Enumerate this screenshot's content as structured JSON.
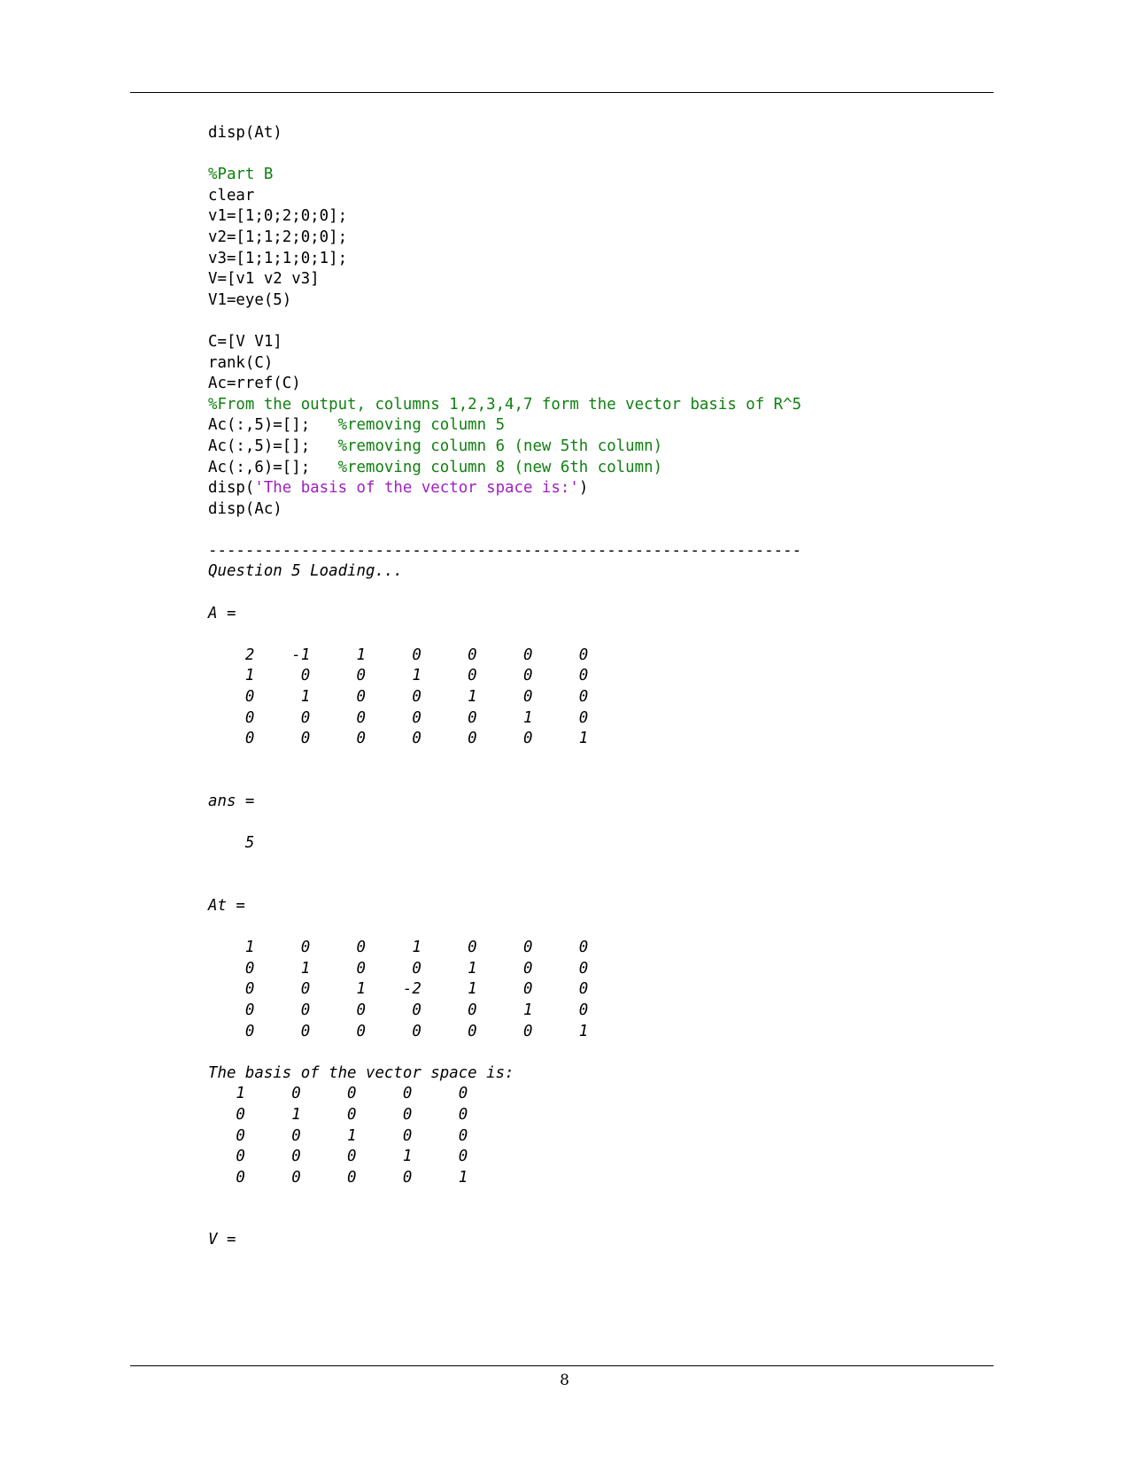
{
  "document": {
    "page_number": "8",
    "has_header_rule": true,
    "has_footer_rule": true,
    "colors": {
      "text": "#000000",
      "comment_green": "#108010",
      "string_purple": "#a020c0"
    }
  },
  "code": {
    "l01": "disp(At)",
    "l02": "",
    "l03_comment": "%Part B",
    "l04": "clear",
    "l05": "v1=[1;0;2;0;0];",
    "l06": "v2=[1;1;2;0;0];",
    "l07": "v3=[1;1;1;0;1];",
    "l08": "V=[v1 v2 v3]",
    "l09": "V1=eye(5)",
    "l10": "",
    "l11": "C=[V V1]",
    "l12": "rank(C)",
    "l13": "Ac=rref(C)",
    "l14_comment": "%From the output, columns 1,2,3,4,7 form the vector basis of R^5",
    "l15_code": "Ac(:,5)=[];",
    "l15_comment": "   %removing column 5",
    "l16_code": "Ac(:,5)=[];",
    "l16_comment": "   %removing column 6 (new 5th column)",
    "l17_code": "Ac(:,6)=[];",
    "l17_comment": "   %removing column 8 (new 6th column)",
    "l18_code_a": "disp(",
    "l18_string": "'The basis of the vector space is:'",
    "l18_code_b": ")",
    "l19": "disp(Ac)"
  },
  "output": {
    "separator": "----------------------------------------------------------------",
    "loading": "Question 5 Loading...",
    "label_A": "A =",
    "matrix_A": [
      "    2    -1     1     0     0     0     0",
      "    1     0     0     1     0     0     0",
      "    0     1     0     0     1     0     0",
      "    0     0     0     0     0     1     0",
      "    0     0     0     0     0     0     1"
    ],
    "label_ans": "ans =",
    "ans_value": "    5",
    "label_At": "At =",
    "matrix_At": [
      "    1     0     0     1     0     0     0",
      "    0     1     0     0     1     0     0",
      "    0     0     1    -2     1     0     0",
      "    0     0     0     0     0     1     0",
      "    0     0     0     0     0     0     1"
    ],
    "basis_header": "The basis of the vector space is:",
    "matrix_basis": [
      "   1     0     0     0     0",
      "   0     1     0     0     0",
      "   0     0     1     0     0",
      "   0     0     0     1     0",
      "   0     0     0     0     1"
    ],
    "label_V": "V ="
  }
}
